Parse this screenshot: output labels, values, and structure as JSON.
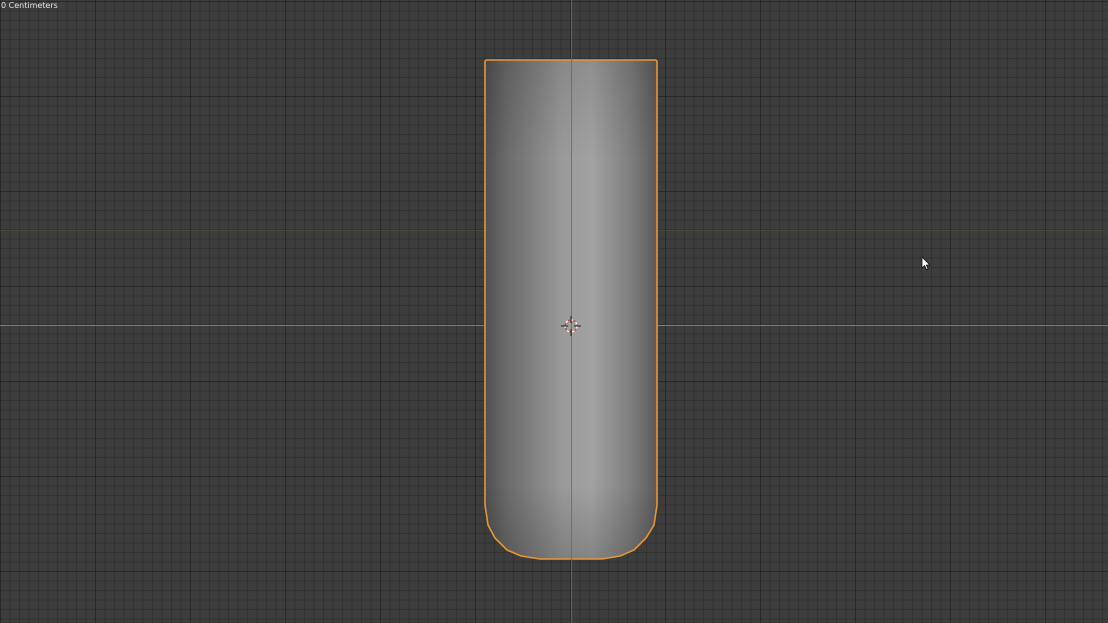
{
  "viewport": {
    "unit_label": "0 Centimeters"
  },
  "colors": {
    "background": "#3d3d3d",
    "x_axis": "#8a9a2a",
    "y_axis": "#4a6fb0",
    "selection_outline": "#e59a3a",
    "object_shade": "#8c8c8c"
  },
  "icons": {
    "origin": "3d-cursor-icon",
    "pointer": "mouse-cursor-icon"
  }
}
